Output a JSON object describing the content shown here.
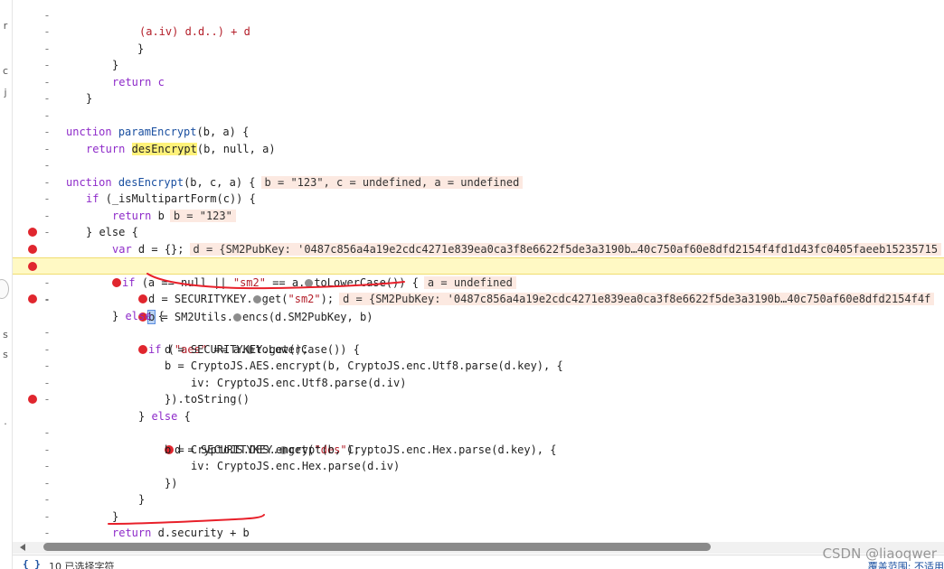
{
  "left_strip_chars": {
    "t1": "r",
    "c": "c",
    "j": "j",
    "s1": "s",
    "s2": "s",
    "dot": "."
  },
  "lines": {
    "l1_str": "(a.iv) d.d..) + d",
    "l2": "}",
    "l3": "}",
    "l4": "return c",
    "l5": "}",
    "l6_kw": "unction",
    "l6_fn": "paramEncrypt",
    "l6_rest": "(b, a) {",
    "l7_kw": "return",
    "l7_fn": "desEncrypt",
    "l7_rest": "(b, null, a)",
    "l8_kw": "unction",
    "l8_fn": "desEncrypt",
    "l8_rest": "(b, c, a) {",
    "l8_eval": "b = \"123\", c = undefined, a = undefined",
    "l9_kw": "if",
    "l9_rest": "(_isMultipartForm(c)) {",
    "l10_kw": "return",
    "l10_rest": "b",
    "l10_eval": "b = \"123\"",
    "l11": "} else {",
    "l12_kw": "var",
    "l12_rest": "d = {};",
    "l12_eval": "d = {SM2PubKey: '0487c856a4a19e2cdc4271e839ea0ca3f8e6622f5de3a3190b…40c750af60e8dfd2154f4fd1d43fc0405faeeb15235715",
    "l13_kw": "if",
    "l13_a": "(a == null || ",
    "l13_str": "\"sm2\"",
    "l13_b": " == a.",
    "l13_c": "toLowerCase()) {",
    "l13_eval": "a = undefined",
    "l14_a": "d = SECURITYKEY.",
    "l14_b": "get(",
    "l14_str": "\"sm2\"",
    "l14_c": ");",
    "l14_eval": "d = {SM2PubKey: '0487c856a4a19e2cdc4271e839ea0ca3f8e6622f5de3a3190b…40c750af60e8dfd2154f4f",
    "l15_sel": "b",
    "l15_a": " = SM2Utils.",
    "l15_b": "encs(d.SM2PubKey, b)",
    "l16_a": "} ",
    "l16_kw": "else",
    "l16_b": " {",
    "l17_kw": "if",
    "l17_a": " (",
    "l17_str": "\"aes\"",
    "l17_b": " == a.",
    "l17_c": "toLowerCase()) {",
    "l18": "d = SECURITYKEY.get();",
    "l19": "b = CryptoJS.AES.encrypt(b, CryptoJS.enc.Utf8.parse(d.key), {",
    "l20": "iv: CryptoJS.enc.Utf8.parse(d.iv)",
    "l21": "}).toString()",
    "l22_a": "} ",
    "l22_kw": "else",
    "l22_b": " {",
    "l23_a": "d = SECURITYKEY.",
    "l23_b": "get(",
    "l23_str": "\"des\"",
    "l23_c": ");",
    "l24": "b = CryptoJS.DES.encrypt(b, CryptoJS.enc.Hex.parse(d.key), {",
    "l25": "iv: CryptoJS.enc.Hex.parse(d.iv)",
    "l26": "})",
    "l27": "}",
    "l28": "}",
    "l29_kw": "return",
    "l29_rest": "d.security + b",
    "l30": "}"
  },
  "gutter_dash": "-",
  "status_bar": {
    "braces": "{ }",
    "text": "10 已选择字符",
    "coverage": "覆盖范围: 不适用"
  },
  "watermark": "CSDN @liaoqwer",
  "colors": {
    "breakpoint": "#e0262e",
    "highlight_line": "#fff9c4",
    "eval_bg": "#fce9e1",
    "keyword": "#8e2bc9",
    "function": "#1a4fa0",
    "annotation": "#e8202a"
  }
}
